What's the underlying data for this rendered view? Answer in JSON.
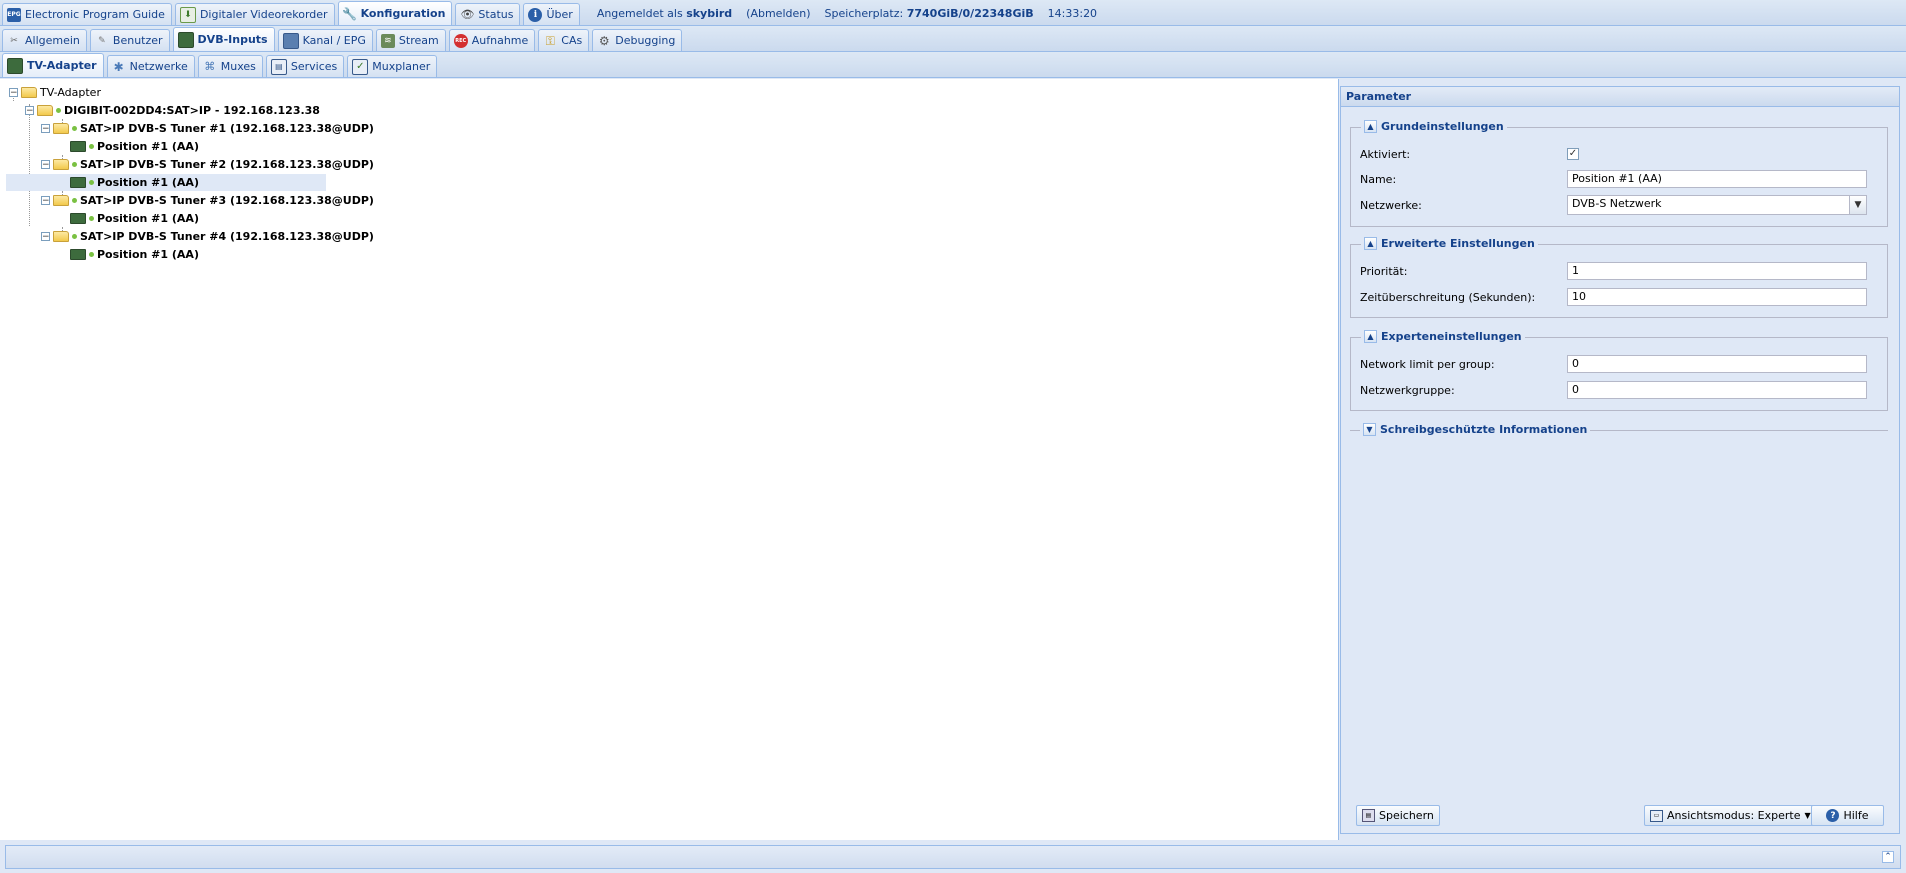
{
  "main_tabs": [
    {
      "label": "Electronic Program Guide",
      "icon": "epg-icon",
      "active": false
    },
    {
      "label": "Digitaler Videorekorder",
      "icon": "dvr-icon",
      "active": false
    },
    {
      "label": "Konfiguration",
      "icon": "wrench-icon",
      "active": true
    },
    {
      "label": "Status",
      "icon": "eye-icon",
      "active": false
    },
    {
      "label": "Über",
      "icon": "info-icon",
      "active": false
    }
  ],
  "header_info": {
    "logged_in_prefix": "Angemeldet als",
    "username": "skybird",
    "logout": "(Abmelden)",
    "storage_prefix": "Speicherplatz:",
    "storage_value": "7740GiB/0/22348GiB",
    "time": "14:33:20"
  },
  "config_tabs": [
    {
      "label": "Allgemein",
      "icon": "tools-icon"
    },
    {
      "label": "Benutzer",
      "icon": "users-icon"
    },
    {
      "label": "DVB-Inputs",
      "icon": "dvb-card-icon"
    },
    {
      "label": "Kanal / EPG",
      "icon": "tv-icon"
    },
    {
      "label": "Stream",
      "icon": "stream-icon"
    },
    {
      "label": "Aufnahme",
      "icon": "rec-icon"
    },
    {
      "label": "CAs",
      "icon": "key-icon"
    },
    {
      "label": "Debugging",
      "icon": "debug-icon"
    }
  ],
  "dvb_tabs": [
    {
      "label": "TV-Adapter",
      "icon": "adapter-icon"
    },
    {
      "label": "Netzwerke",
      "icon": "network-icon"
    },
    {
      "label": "Muxes",
      "icon": "mux-icon"
    },
    {
      "label": "Services",
      "icon": "services-icon"
    },
    {
      "label": "Muxplaner",
      "icon": "muxplan-icon"
    }
  ],
  "tree": {
    "root": "TV-Adapter",
    "device": "DIGIBIT-002DD4:SAT>IP - 192.168.123.38",
    "tuners": [
      {
        "label": "SAT>IP DVB-S Tuner #1 (192.168.123.38@UDP)",
        "child": "Position #1 (AA)"
      },
      {
        "label": "SAT>IP DVB-S Tuner #2 (192.168.123.38@UDP)",
        "child": "Position #1 (AA)"
      },
      {
        "label": "SAT>IP DVB-S Tuner #3 (192.168.123.38@UDP)",
        "child": "Position #1 (AA)"
      },
      {
        "label": "SAT>IP DVB-S Tuner #4 (192.168.123.38@UDP)",
        "child": "Position #1 (AA)"
      }
    ]
  },
  "params": {
    "title": "Parameter",
    "basic": {
      "title": "Grundeinstellungen",
      "enabled_label": "Aktiviert:",
      "enabled": true,
      "name_label": "Name:",
      "name_value": "Position #1 (AA)",
      "networks_label": "Netzwerke:",
      "networks_value": "DVB-S Netzwerk"
    },
    "advanced": {
      "title": "Erweiterte Einstellungen",
      "priority_label": "Priorität:",
      "priority_value": "1",
      "timeout_label": "Zeitüberschreitung (Sekunden):",
      "timeout_value": "10"
    },
    "expert": {
      "title": "Experteneinstellungen",
      "netlimit_label": "Network limit per group:",
      "netlimit_value": "0",
      "netgroup_label": "Netzwerkgruppe:",
      "netgroup_value": "0"
    },
    "readonly": {
      "title": "Schreibgeschützte Informationen"
    },
    "save_button": "Speichern",
    "view_mode_button": "Ansichtsmodus: Experte",
    "help_button": "Hilfe"
  },
  "colors": {
    "accent": "#15428b",
    "panel_bg": "#dfe8f6",
    "border": "#99bbe8",
    "status_green": "#7ac142"
  }
}
